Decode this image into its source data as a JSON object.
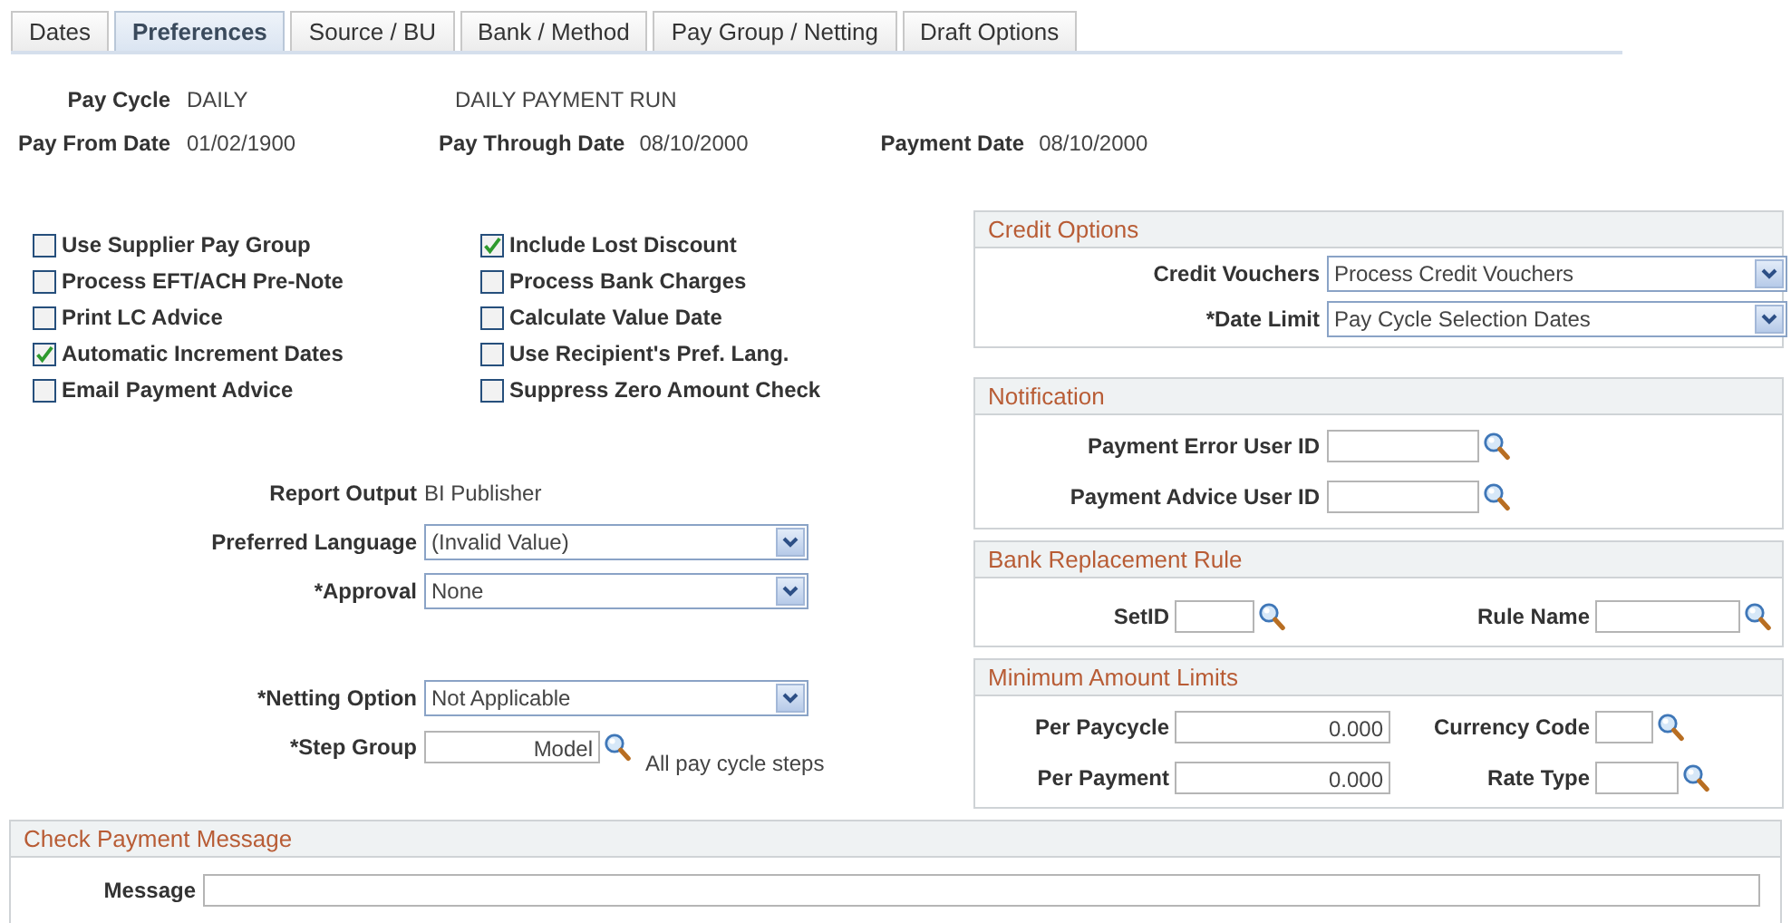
{
  "tabs": [
    {
      "label": "Dates",
      "selected": false
    },
    {
      "label": "Preferences",
      "selected": true
    },
    {
      "label": "Source / BU",
      "selected": false
    },
    {
      "label": "Bank / Method",
      "selected": false
    },
    {
      "label": "Pay Group / Netting",
      "selected": false
    },
    {
      "label": "Draft Options",
      "selected": false
    }
  ],
  "header": {
    "pay_cycle": {
      "label": "Pay Cycle",
      "value": "DAILY",
      "description": "DAILY PAYMENT RUN"
    },
    "pay_from_date": {
      "label": "Pay From Date",
      "value": "01/02/1900"
    },
    "pay_through_date": {
      "label": "Pay Through Date",
      "value": "08/10/2000"
    },
    "payment_date": {
      "label": "Payment Date",
      "value": "08/10/2000"
    }
  },
  "checkbox_columns": [
    [
      {
        "label": "Use Supplier Pay Group",
        "checked": false
      },
      {
        "label": "Process EFT/ACH Pre-Note",
        "checked": false
      },
      {
        "label": "Print LC Advice",
        "checked": false
      },
      {
        "label": "Automatic Increment Dates",
        "checked": true
      },
      {
        "label": "Email Payment Advice",
        "checked": false
      }
    ],
    [
      {
        "label": "Include Lost Discount",
        "checked": true
      },
      {
        "label": "Process Bank Charges",
        "checked": false
      },
      {
        "label": "Calculate Value Date",
        "checked": false
      },
      {
        "label": "Use Recipient's Pref. Lang.",
        "checked": false
      },
      {
        "label": "Suppress Zero Amount Check",
        "checked": false
      }
    ]
  ],
  "report_fields": [
    {
      "kind": "display",
      "label": "Report Output",
      "value": "BI Publisher"
    },
    {
      "kind": "dropdown",
      "label": "Preferred Language",
      "value": "(Invalid Value)"
    },
    {
      "kind": "dropdown",
      "label": "*Approval",
      "value": "None"
    }
  ],
  "netting_fields": [
    {
      "kind": "dropdown",
      "label": "*Netting Option",
      "value": "Not Applicable"
    },
    {
      "kind": "lookup",
      "label": "*Step Group",
      "value": "Model",
      "description": "All pay cycle steps"
    }
  ],
  "credit_options": {
    "title": "Credit Options",
    "fields": [
      {
        "kind": "dropdown",
        "label": "Credit Vouchers",
        "value": "Process Credit Vouchers"
      },
      {
        "kind": "dropdown",
        "label": "*Date Limit",
        "value": "Pay Cycle Selection Dates"
      }
    ]
  },
  "notification": {
    "title": "Notification",
    "fields": [
      {
        "kind": "lookup",
        "label": "Payment Error User ID"
      },
      {
        "kind": "lookup",
        "label": "Payment Advice User ID"
      }
    ]
  },
  "bank_replacement_rule": {
    "title": "Bank Replacement Rule",
    "fields": [
      {
        "kind": "lookup",
        "label": "SetID"
      },
      {
        "kind": "lookup",
        "label": "Rule Name"
      }
    ]
  },
  "minimum_amount_limits": {
    "title": "Minimum Amount Limits",
    "fields": [
      {
        "kind": "number",
        "label": "Per Paycycle",
        "value": "0.000"
      },
      {
        "kind": "lookup",
        "label": "Currency Code"
      },
      {
        "kind": "number",
        "label": "Per Payment",
        "value": "0.000"
      },
      {
        "kind": "lookup",
        "label": "Rate Type"
      }
    ]
  },
  "check_payment_message": {
    "title": "Check Payment Message",
    "fields": [
      {
        "kind": "text",
        "label": "Message"
      }
    ]
  }
}
